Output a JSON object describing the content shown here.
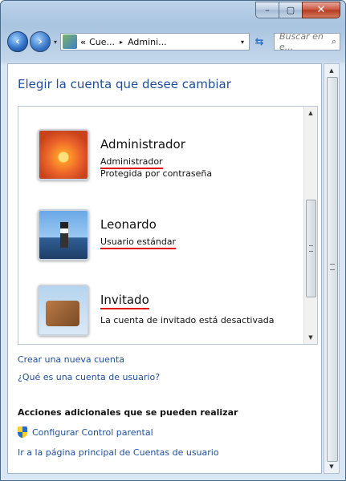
{
  "window": {
    "caption_buttons": {
      "minimize": "–",
      "maximize": "▢",
      "close": "✕"
    }
  },
  "navbar": {
    "back_icon": "back-arrow-icon",
    "forward_icon": "forward-arrow-icon",
    "recent_pages_glyph": "▾",
    "address": {
      "overflow_chevron": "«",
      "crumbs": [
        "Cue...",
        "Admini..."
      ],
      "separator": "▸",
      "dropdown_glyph": "▾"
    },
    "refresh_glyph": "⇆",
    "search_placeholder": "Buscar en e...",
    "search_icon": "⌕"
  },
  "main": {
    "title": "Elegir la cuenta que desee cambiar",
    "accounts": [
      {
        "name": "Administrador",
        "type": "Administrador",
        "status": "Protegida por contraseña",
        "picture": "orange-flower"
      },
      {
        "name": "Leonardo",
        "type": "Usuario estándar",
        "status": "",
        "picture": "lighthouse"
      },
      {
        "name": "Invitado",
        "type": "La cuenta de invitado está desactivada",
        "status": "",
        "picture": "suitcase"
      }
    ],
    "links": {
      "create_account": "Crear una nueva cuenta",
      "what_is_account": "¿Qué es una cuenta de usuario?"
    },
    "additional_actions": {
      "heading": "Acciones adicionales que se pueden realizar",
      "parental_control": "Configurar Control parental",
      "main_page": "Ir a la página principal de Cuentas de usuario"
    }
  },
  "scroll": {
    "up_glyph": "▲",
    "down_glyph": "▼"
  },
  "colors": {
    "link": "#1e4e9c",
    "highlight_underline": "#e01010"
  }
}
